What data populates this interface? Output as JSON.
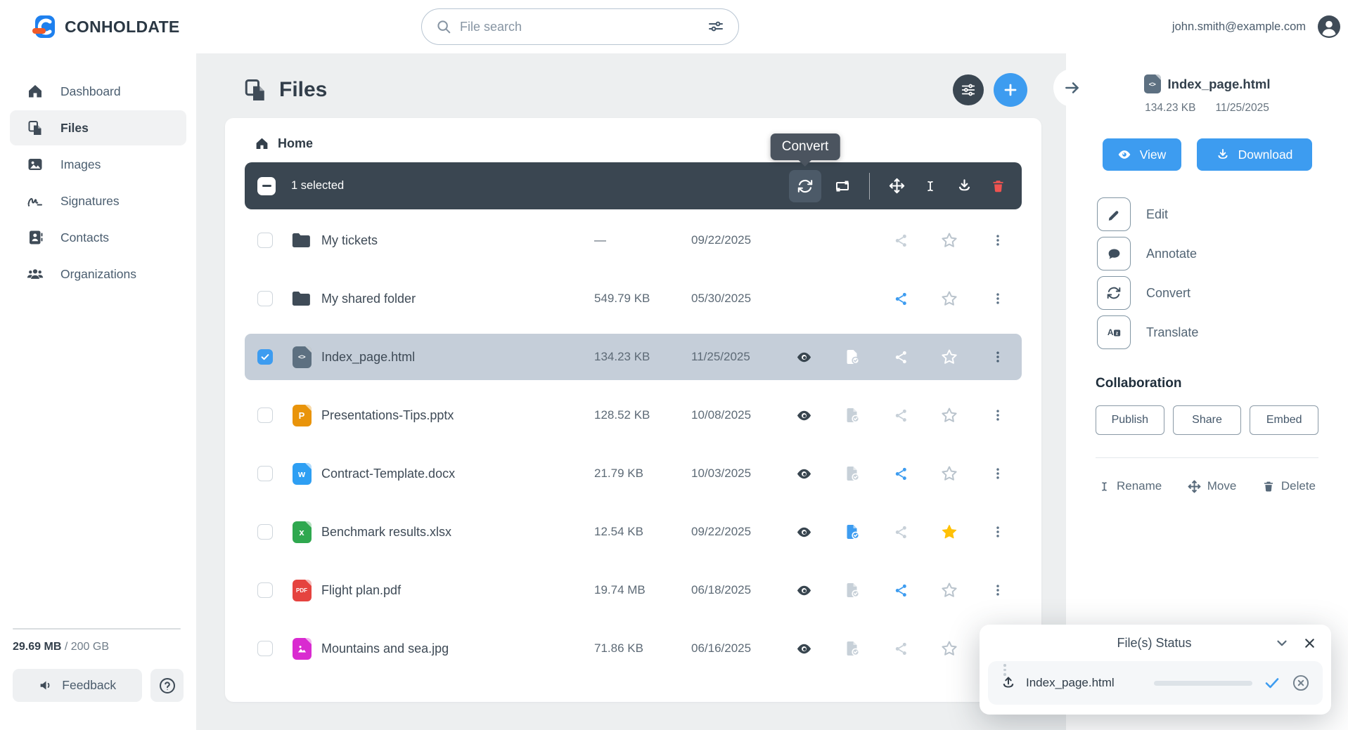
{
  "header": {
    "brand": "CONHOLDATE",
    "search_placeholder": "File search",
    "user_email": "john.smith@example.com"
  },
  "sidebar": {
    "items": [
      {
        "label": "Dashboard",
        "active": false
      },
      {
        "label": "Files",
        "active": true
      },
      {
        "label": "Images",
        "active": false
      },
      {
        "label": "Signatures",
        "active": false
      },
      {
        "label": "Contacts",
        "active": false
      },
      {
        "label": "Organizations",
        "active": false
      }
    ],
    "storage_used": "29.69 MB",
    "storage_separator": "/",
    "storage_total": "200 GB",
    "feedback_label": "Feedback"
  },
  "main": {
    "title": "Files",
    "breadcrumb": "Home",
    "toolbar": {
      "selected_count": "1 selected",
      "tooltip": "Convert"
    },
    "files": {
      "rows": [
        {
          "name": "My tickets",
          "type": "folder",
          "badge": "",
          "size": "—",
          "date": "09/22/2025",
          "selected": false,
          "eye": false,
          "filecheck": "none",
          "share": "gray",
          "star": "gray"
        },
        {
          "name": "My shared folder",
          "type": "folder",
          "badge": "",
          "size": "549.79 KB",
          "date": "05/30/2025",
          "selected": false,
          "eye": false,
          "filecheck": "none",
          "share": "blue",
          "star": "gray"
        },
        {
          "name": "Index_page.html",
          "type": "html",
          "badge": "<>",
          "size": "134.23 KB",
          "date": "11/25/2025",
          "selected": true,
          "eye": true,
          "filecheck": "white",
          "share": "white",
          "star": "white"
        },
        {
          "name": "Presentations-Tips.pptx",
          "type": "pptx",
          "badge": "P",
          "size": "128.52 KB",
          "date": "10/08/2025",
          "selected": false,
          "eye": true,
          "filecheck": "gray",
          "share": "gray",
          "star": "gray"
        },
        {
          "name": "Contract-Template.docx",
          "type": "docx",
          "badge": "W",
          "size": "21.79 KB",
          "date": "10/03/2025",
          "selected": false,
          "eye": true,
          "filecheck": "gray",
          "share": "blue",
          "star": "gray"
        },
        {
          "name": "Benchmark results.xlsx",
          "type": "xlsx",
          "badge": "X",
          "size": "12.54 KB",
          "date": "09/22/2025",
          "selected": false,
          "eye": true,
          "filecheck": "blue",
          "share": "gray",
          "star": "yellow"
        },
        {
          "name": "Flight plan.pdf",
          "type": "pdf",
          "badge": "PDF",
          "size": "19.74 MB",
          "date": "06/18/2025",
          "selected": false,
          "eye": true,
          "filecheck": "gray",
          "share": "blue",
          "star": "gray"
        },
        {
          "name": "Mountains and sea.jpg",
          "type": "jpg",
          "badge": "",
          "size": "71.86 KB",
          "date": "06/16/2025",
          "selected": false,
          "eye": true,
          "filecheck": "gray",
          "share": "gray",
          "star": "gray"
        }
      ]
    }
  },
  "right_panel": {
    "file_name": "Index_page.html",
    "file_icon_label": "<>",
    "file_size": "134.23 KB",
    "file_date": "11/25/2025",
    "view_label": "View",
    "download_label": "Download",
    "actions": [
      "Edit",
      "Annotate",
      "Convert",
      "Translate"
    ],
    "collaboration_title": "Collaboration",
    "collab_buttons": [
      "Publish",
      "Share",
      "Embed"
    ],
    "footer_actions": [
      "Rename",
      "Move",
      "Delete"
    ]
  },
  "status_popup": {
    "title": "File(s) Status",
    "file_name": "Index_page.html",
    "progress_percent": 100
  },
  "colors": {
    "accent_blue": "#3d9cf0",
    "toolbar_dark": "#3a4651",
    "selected_row": "#c5ced9",
    "star_yellow": "#ffc107",
    "delete_red": "#ea5350"
  }
}
